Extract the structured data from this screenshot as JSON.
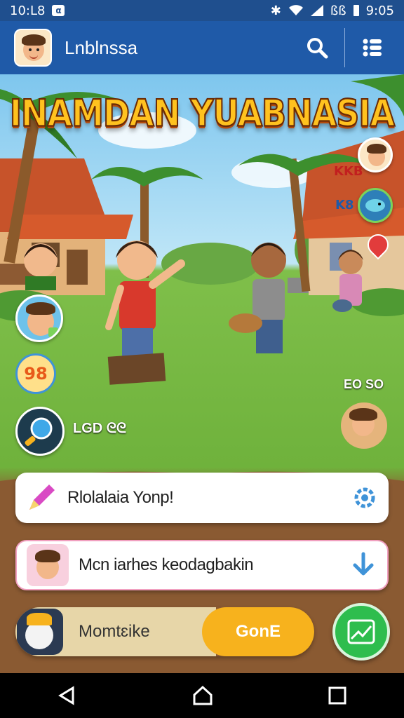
{
  "status_bar": {
    "time": "10:L8",
    "notif_badge": "α",
    "right_text": "ßß",
    "clock": "9:05"
  },
  "app_bar": {
    "title": "Lnblnssa",
    "search_icon": "search-icon",
    "menu_icon": "list-menu-icon"
  },
  "game": {
    "title": "INAMDAN YUABNASIA",
    "sign_a": "KKB",
    "sign_b": "K8",
    "badge_98": "98",
    "score_right": "EO SO",
    "level_label": "LGD",
    "level_icon_text": "ᘓᘓ"
  },
  "cards": [
    {
      "label": "Rlolalaia Yonp!",
      "action_icon": "gear-icon"
    },
    {
      "label": "Mcn iarhes keodagbakin",
      "action_icon": "download-arrow-icon"
    }
  ],
  "bottom": {
    "left_label": "Momtɛike",
    "right_label": "GonE",
    "trend_icon": "trend-chart-icon"
  },
  "colors": {
    "brand_blue": "#1f5aa8",
    "title_gold": "#ffc21f",
    "go_orange": "#f7b21d",
    "trend_green": "#2ebd4e"
  }
}
